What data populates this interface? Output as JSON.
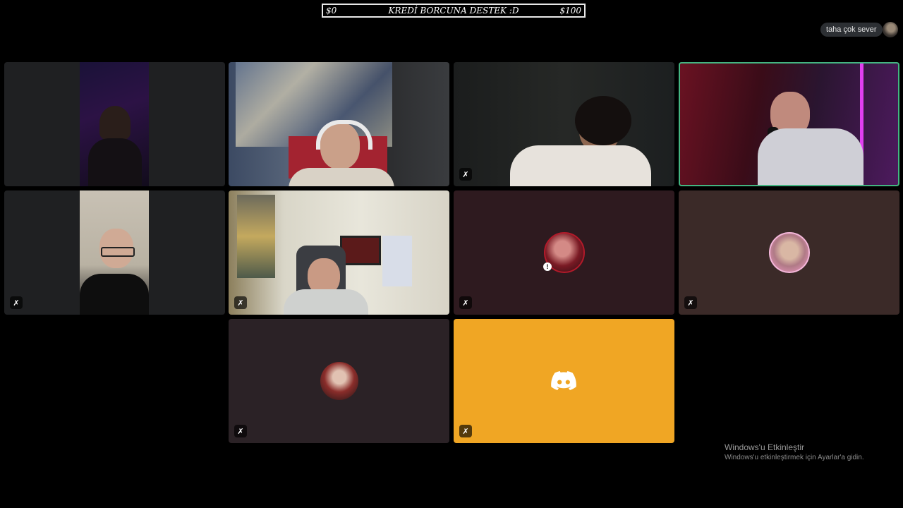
{
  "goal_bar": {
    "left_value": "$0",
    "title": "KREDİ BORCUNA DESTEK :D",
    "right_value": "$100"
  },
  "user": {
    "name": "taha çok sever"
  },
  "tiles": [
    {
      "kind": "video",
      "muted": false
    },
    {
      "kind": "video",
      "muted": false
    },
    {
      "kind": "video",
      "muted": true,
      "mute_icon": "mic-off-icon"
    },
    {
      "kind": "video",
      "muted": false,
      "speaking": true
    },
    {
      "kind": "video",
      "muted": true,
      "mute_icon": "mic-off-icon"
    },
    {
      "kind": "video",
      "muted": true,
      "mute_icon": "mic-off-icon"
    },
    {
      "kind": "avatar",
      "muted": true,
      "mute_icon": "mic-off-icon",
      "background": "#2e1a1f"
    },
    {
      "kind": "avatar",
      "muted": true,
      "mute_icon": "mic-off-icon",
      "background": "#3b2a28"
    },
    {
      "kind": "avatar",
      "muted": true,
      "mute_icon": "mic-off-icon",
      "background": "#2b2226"
    },
    {
      "kind": "discord-logo",
      "muted": true,
      "mute_icon": "mic-off-icon",
      "background": "#f0a624"
    }
  ],
  "icons": {
    "mute": "✗",
    "discord": "discord-logo-icon"
  },
  "colors": {
    "speaking_border": "#43b581",
    "discord_tile": "#f0a624"
  },
  "watermark": {
    "title": "Windows'u Etkinleştir",
    "subtitle": "Windows'u etkinleştirmek için Ayarlar'a gidin."
  }
}
